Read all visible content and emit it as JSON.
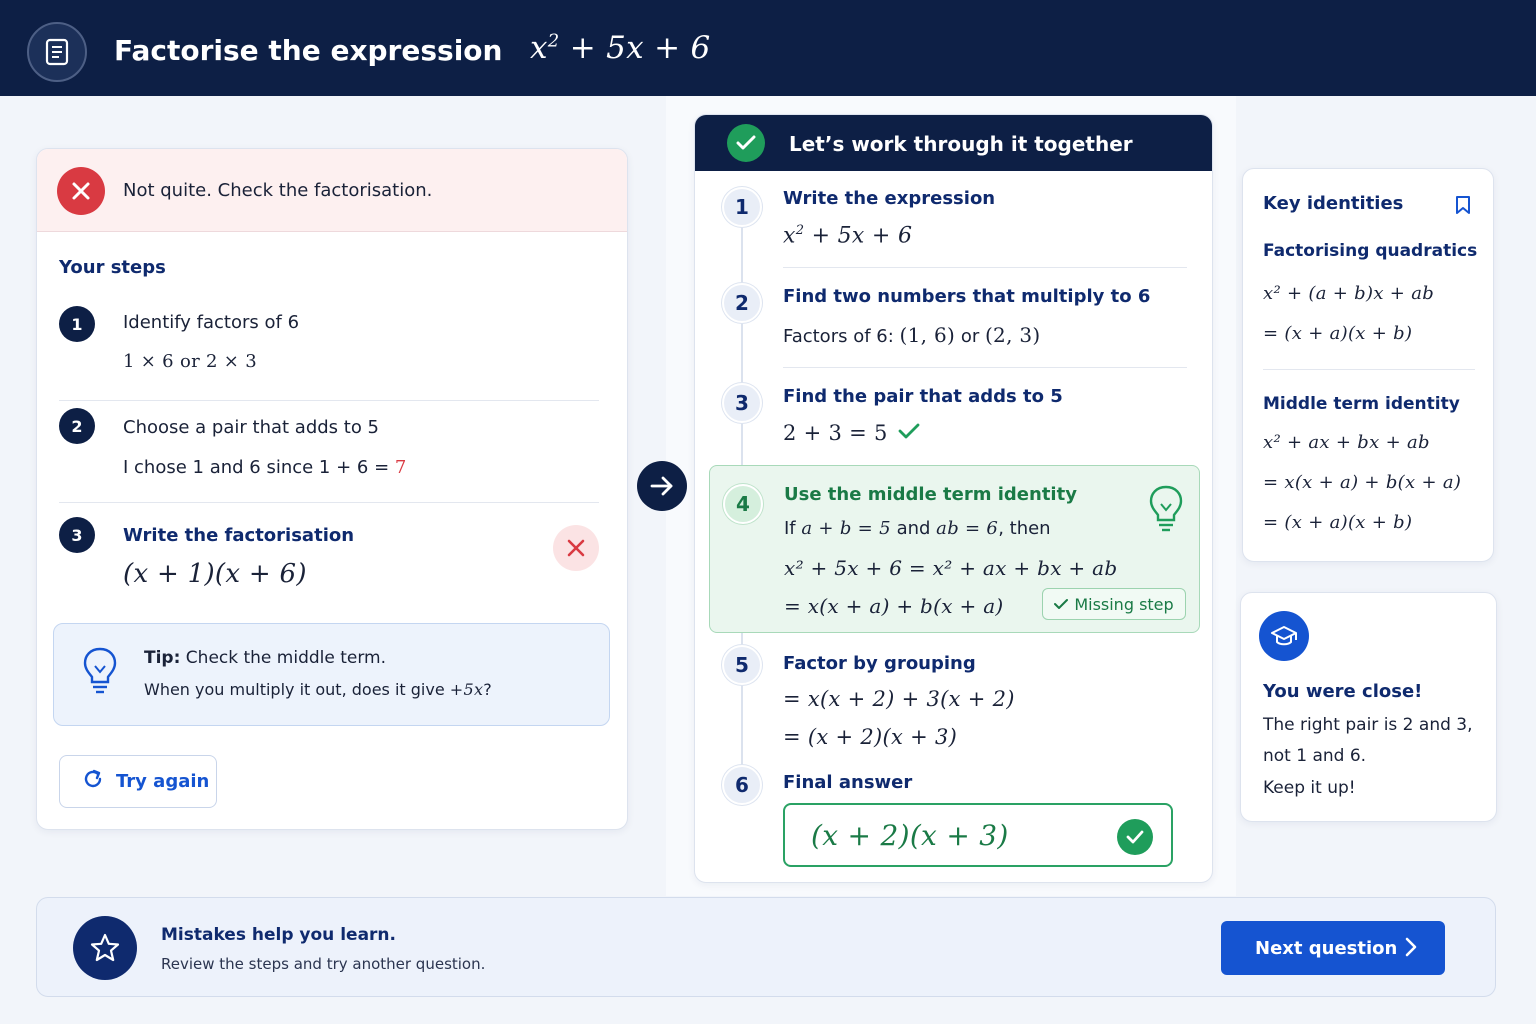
{
  "header": {
    "title": "Factorise the expression",
    "expression_base": "x",
    "expression_sup": "2",
    "expression_rest": " + 5x + 6",
    "icon": "document-icon"
  },
  "feedback": {
    "message": "Not quite. Check the factorisation.",
    "icon": "close-icon"
  },
  "your_steps": {
    "title": "Your steps",
    "steps": [
      {
        "number": "1",
        "label": "Identify factors of 6",
        "body": "1 × 6  or  2 × 3"
      },
      {
        "number": "2",
        "label": "Choose a pair that adds to 5",
        "body_prefix": "I chose 1 and 6 since 1 + 6 = ",
        "body_wrong": "7"
      },
      {
        "number": "3",
        "label": "Write the factorisation",
        "body": "(x + 1)(x + 6)"
      }
    ]
  },
  "tip": {
    "bold": "Tip:",
    "line1": " Check the middle term.",
    "line2_prefix": "When you multiply it out, does it give ",
    "line2_math": "+5x",
    "line2_suffix": "?"
  },
  "try_again": {
    "label": "Try again"
  },
  "walkthrough": {
    "title": "Let’s work through it together",
    "steps": [
      {
        "number": "1",
        "label": "Write the expression",
        "body_base": "x",
        "body_sup": "2",
        "body_rest": " + 5x + 6"
      },
      {
        "number": "2",
        "label": "Find two numbers that multiply to 6",
        "body_prefix": "Factors of 6: ",
        "body_a": "(1, 6)",
        "body_mid": " or ",
        "body_b": "(2, 3)"
      },
      {
        "number": "3",
        "label": "Find the pair that adds to 5",
        "body": "2 + 3 = 5"
      },
      {
        "number": "4",
        "label": "Use the middle term identity",
        "line1_a": "If ",
        "line1_b": "a + b = 5",
        "line1_c": " and ",
        "line1_d": "ab = 6",
        "line1_e": ", then",
        "line2": "x² + 5x + 6 = x² + ax + bx + ab",
        "line3": "= x(x + a) + b(x + a)",
        "badge": "Missing step"
      },
      {
        "number": "5",
        "label": "Factor by grouping",
        "line1": "= x(x + 2) + 3(x + 2)",
        "line2": "= (x + 2)(x + 3)"
      },
      {
        "number": "6",
        "label": "Final answer",
        "answer": "(x + 2)(x + 3)"
      }
    ]
  },
  "key_identities": {
    "title": "Key identities",
    "sections": [
      {
        "title": "Factorising quadratics",
        "lines": [
          "x² + (a + b)x + ab",
          "= (x + a)(x + b)"
        ]
      },
      {
        "title": "Middle term identity",
        "lines": [
          "x² + ax + bx + ab",
          "= x(x + a) + b(x + a)",
          "= (x + a)(x + b)"
        ]
      }
    ]
  },
  "encouragement": {
    "title": "You were close!",
    "line1": "The right pair is 2 and 3,",
    "line2": "not 1 and 6.",
    "line3": "Keep it up!"
  },
  "bottom": {
    "title": "Mistakes help you learn.",
    "subtitle": "Review the steps and try another question.",
    "next_label": "Next question"
  },
  "colors": {
    "navy": "#0d1f45",
    "blue": "#1554d1",
    "green": "#1f9d5b",
    "red": "#d93a42"
  }
}
